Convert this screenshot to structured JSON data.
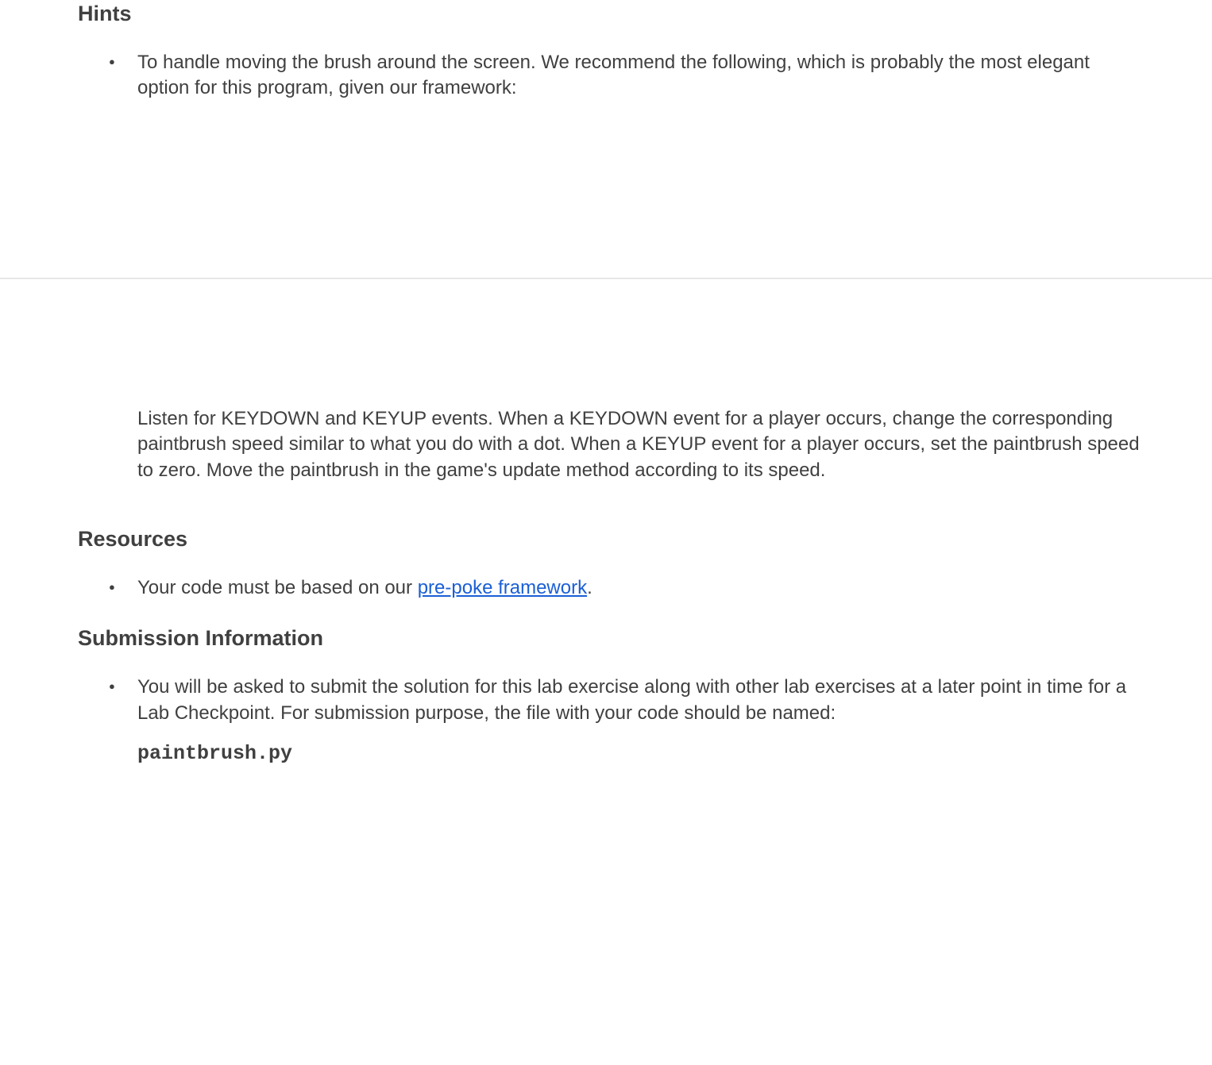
{
  "hints": {
    "heading": "Hints",
    "bullet1": "To handle moving the brush around the screen. We recommend the following, which is probably the most elegant option for this program, given our framework:",
    "paragraph": "Listen for KEYDOWN and KEYUP events. When a KEYDOWN event for a player occurs, change the corresponding paintbrush speed similar to what you do with a dot. When a KEYUP event for a player occurs, set the paintbrush speed to zero. Move the paintbrush in the game's update method according to its speed."
  },
  "resources": {
    "heading": "Resources",
    "bullet_prefix": "Your code must be based on our ",
    "link_text": "pre-poke framework",
    "bullet_suffix": "."
  },
  "submission": {
    "heading": "Submission Information",
    "bullet1": "You will be asked to submit the solution for this lab exercise along with other lab exercises at a later point in time for a Lab Checkpoint. For submission purpose, the file with your code should be named:",
    "filename": "paintbrush.py"
  }
}
